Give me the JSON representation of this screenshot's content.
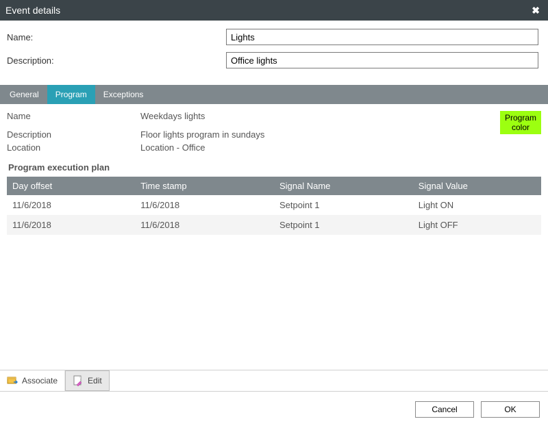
{
  "window": {
    "title": "Event details"
  },
  "form": {
    "name_label": "Name:",
    "name_value": "Lights",
    "description_label": "Description:",
    "description_value": "Office lights"
  },
  "tabs": {
    "general": "General",
    "program": "Program",
    "exceptions": "Exceptions"
  },
  "program": {
    "name_label": "Name",
    "name_value": "Weekdays lights",
    "description_label": "Description",
    "description_value": "Floor lights program in sundays",
    "location_label": "Location",
    "location_value": "Location - Office",
    "color_label_line1": "Program",
    "color_label_line2": "color",
    "color_hex": "#9cff10"
  },
  "section": {
    "exec_plan": "Program execution plan"
  },
  "table": {
    "headers": {
      "day_offset": "Day offset",
      "time_stamp": "Time stamp",
      "signal_name": "Signal Name",
      "signal_value": "Signal Value"
    },
    "rows": [
      {
        "day_offset": "11/6/2018",
        "time_stamp": "11/6/2018",
        "signal_name": "Setpoint 1",
        "signal_value": "Light ON"
      },
      {
        "day_offset": "11/6/2018",
        "time_stamp": "11/6/2018",
        "signal_name": "Setpoint 1",
        "signal_value": "Light OFF"
      }
    ]
  },
  "toolbar": {
    "associate": "Associate",
    "edit": "Edit"
  },
  "footer": {
    "cancel": "Cancel",
    "ok": "OK"
  }
}
